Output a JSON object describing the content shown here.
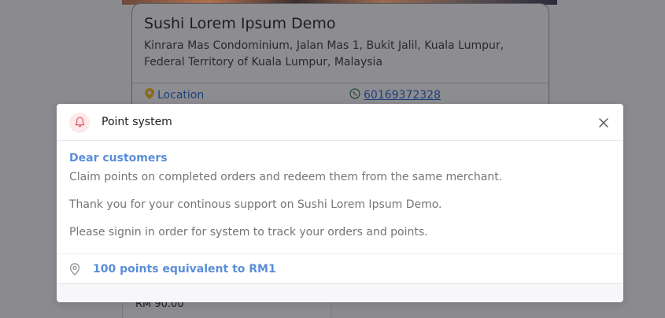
{
  "background": {
    "store": {
      "name": "Sushi Lorem Ipsum Demo",
      "address": "Kinrara Mas Condominium, Jalan Mas 1, Bukit Jalil, Kuala Lumpur, Federal Territory of Kuala Lumpur, Malaysia",
      "location_label": "Location",
      "phone": "60169372328"
    },
    "price_preview": "RM 90.00"
  },
  "modal": {
    "title": "Point system",
    "greeting": "Dear customers",
    "paragraphs": [
      "Claim points on completed orders and redeem them from the same merchant.",
      "Thank you for your continous support on Sushi Lorem Ipsum Demo.",
      "Please signin in order for system to track your orders and points."
    ],
    "points_info": "100 points equivalent to RM1"
  },
  "colors": {
    "accent_blue": "#5b8ed8",
    "bell_red": "#e05a6a",
    "overlay": "#8b8b8f"
  },
  "icons": {
    "header": "bell-icon",
    "close": "close-icon",
    "footer": "map-pin-icon",
    "location": "map-pin-icon",
    "phone": "whatsapp-icon"
  }
}
